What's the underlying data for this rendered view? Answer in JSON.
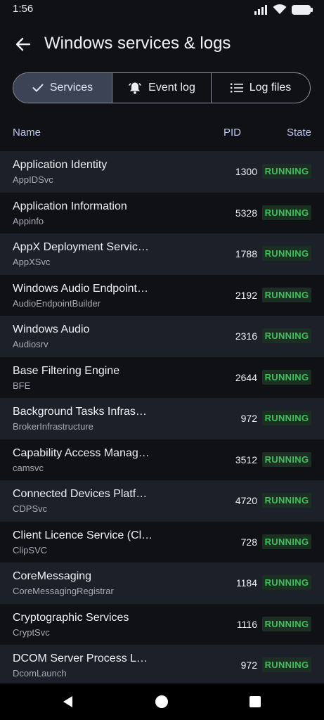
{
  "status": {
    "time": "1:56",
    "icons": [
      "signal-icon",
      "wifi-icon",
      "battery-icon"
    ]
  },
  "appbar": {
    "title": "Windows services & logs",
    "back_icon": "arrow-left-icon"
  },
  "tabs": [
    {
      "label": "Services",
      "icon": "check-icon",
      "active": true
    },
    {
      "label": "Event log",
      "icon": "bell-icon",
      "active": false
    },
    {
      "label": "Log files",
      "icon": "list-icon",
      "active": false
    }
  ],
  "table": {
    "headers": {
      "name": "Name",
      "pid": "PID",
      "state": "State"
    },
    "rows": [
      {
        "name": "Application Identity",
        "service": "AppIDSvc",
        "pid": "1300",
        "state": "RUNNING"
      },
      {
        "name": "Application Information",
        "service": "Appinfo",
        "pid": "5328",
        "state": "RUNNING"
      },
      {
        "name": "AppX Deployment Servic…",
        "service": "AppXSvc",
        "pid": "1788",
        "state": "RUNNING"
      },
      {
        "name": "Windows Audio Endpoint…",
        "service": "AudioEndpointBuilder",
        "pid": "2192",
        "state": "RUNNING"
      },
      {
        "name": "Windows Audio",
        "service": "Audiosrv",
        "pid": "2316",
        "state": "RUNNING"
      },
      {
        "name": "Base Filtering Engine",
        "service": "BFE",
        "pid": "2644",
        "state": "RUNNING"
      },
      {
        "name": "Background Tasks Infras…",
        "service": "BrokerInfrastructure",
        "pid": "972",
        "state": "RUNNING"
      },
      {
        "name": "Capability Access Manag…",
        "service": "camsvc",
        "pid": "3512",
        "state": "RUNNING"
      },
      {
        "name": "Connected Devices Platf…",
        "service": "CDPSvc",
        "pid": "4720",
        "state": "RUNNING"
      },
      {
        "name": "Client Licence Service (Cl…",
        "service": "ClipSVC",
        "pid": "728",
        "state": "RUNNING"
      },
      {
        "name": "CoreMessaging",
        "service": "CoreMessagingRegistrar",
        "pid": "1184",
        "state": "RUNNING"
      },
      {
        "name": "Cryptographic Services",
        "service": "CryptSvc",
        "pid": "1116",
        "state": "RUNNING"
      },
      {
        "name": "DCOM Server Process La…",
        "service": "DcomLaunch",
        "pid": "972",
        "state": "RUNNING"
      }
    ]
  },
  "navbar": {
    "icons": [
      "back-triangle-icon",
      "home-circle-icon",
      "recents-square-icon"
    ]
  },
  "colors": {
    "accent_green": "#3ec15a",
    "badge_bg": "#1b2f22",
    "header_text": "#bcc8ee"
  }
}
